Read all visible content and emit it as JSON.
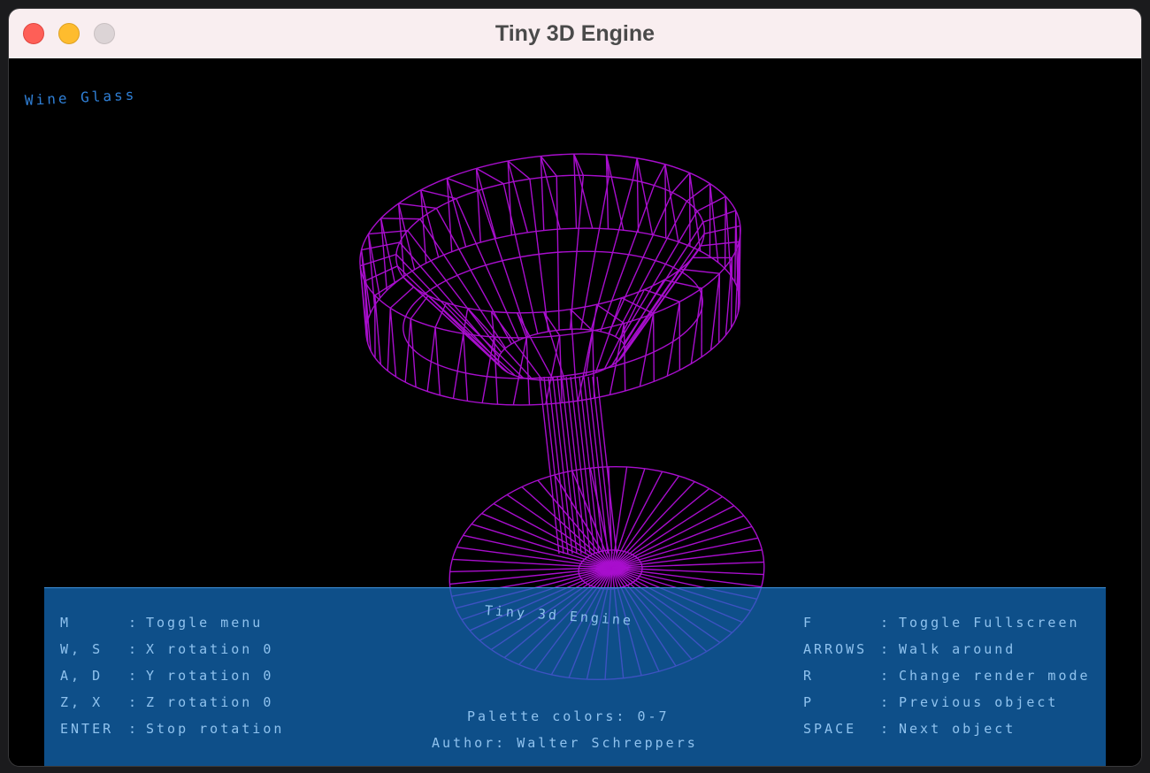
{
  "window": {
    "title": "Tiny 3D Engine"
  },
  "scene": {
    "object_name": "Wine Glass",
    "wire_color": "#b10fd8"
  },
  "menu": {
    "title": "Tiny 3d Engine",
    "left_keys": [
      {
        "key": "M",
        "action": "Toggle menu"
      },
      {
        "key": "W, S",
        "action": "X rotation 0"
      },
      {
        "key": "A, D",
        "action": "Y rotation 0"
      },
      {
        "key": "Z, X",
        "action": "Z rotation 0"
      },
      {
        "key": "ENTER",
        "action": "Stop rotation"
      }
    ],
    "right_keys": [
      {
        "key": "F",
        "action": "Toggle Fullscreen"
      },
      {
        "key": "ARROWS",
        "action": "Walk around"
      },
      {
        "key": "R",
        "action": "Change render mode"
      },
      {
        "key": "P",
        "action": "Previous object"
      },
      {
        "key": "SPACE",
        "action": "Next object"
      }
    ],
    "palette": "Palette colors: 0-7",
    "author": "Author: Walter Schreppers"
  }
}
